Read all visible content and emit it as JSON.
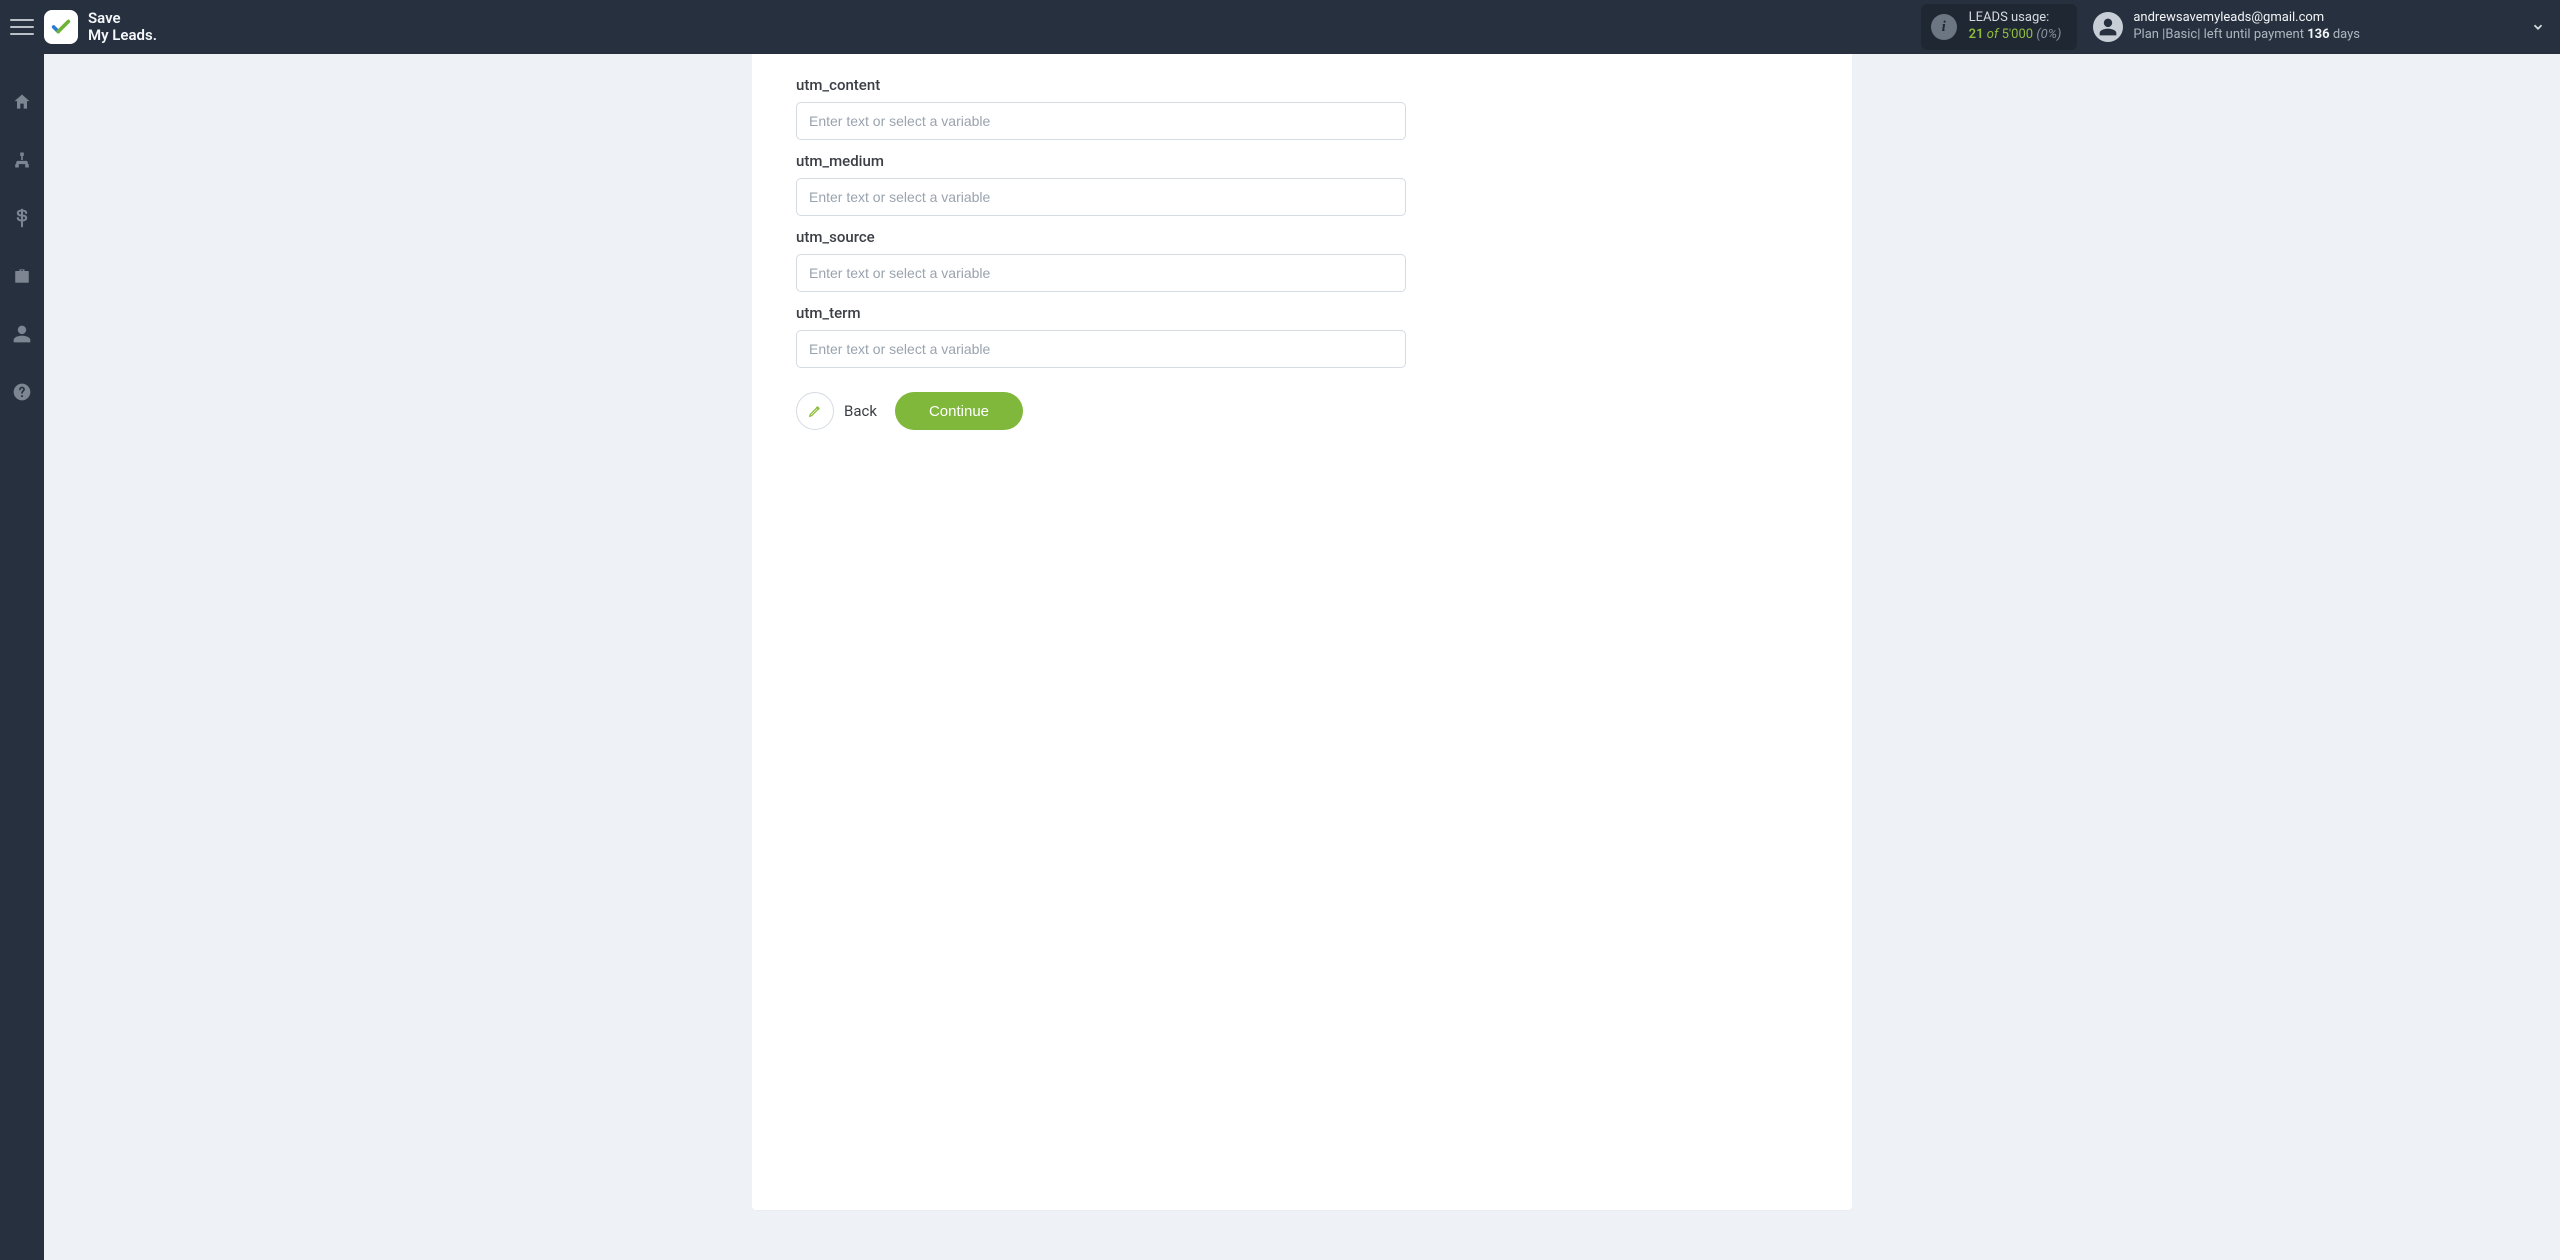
{
  "brand": {
    "line1": "Save",
    "line2": "My Leads."
  },
  "usage": {
    "label": "LEADS usage:",
    "count": "21",
    "of": "of",
    "total": "5'000",
    "pct": "(0%)"
  },
  "account": {
    "email": "andrewsavemyleads@gmail.com",
    "plan_prefix": "Plan |",
    "plan_name": "Basic",
    "plan_mid": "| left until payment ",
    "days_num": "136",
    "days_word": " days"
  },
  "fields": [
    {
      "label": "utm_content",
      "placeholder": "Enter text or select a variable",
      "name": "utm-content-input"
    },
    {
      "label": "utm_medium",
      "placeholder": "Enter text or select a variable",
      "name": "utm-medium-input"
    },
    {
      "label": "utm_source",
      "placeholder": "Enter text or select a variable",
      "name": "utm-source-input"
    },
    {
      "label": "utm_term",
      "placeholder": "Enter text or select a variable",
      "name": "utm-term-input"
    }
  ],
  "actions": {
    "back": "Back",
    "continue": "Continue"
  },
  "sidebar_icons": [
    "home-icon",
    "sitemap-icon",
    "dollar-icon",
    "briefcase-icon",
    "user-icon",
    "help-icon"
  ]
}
